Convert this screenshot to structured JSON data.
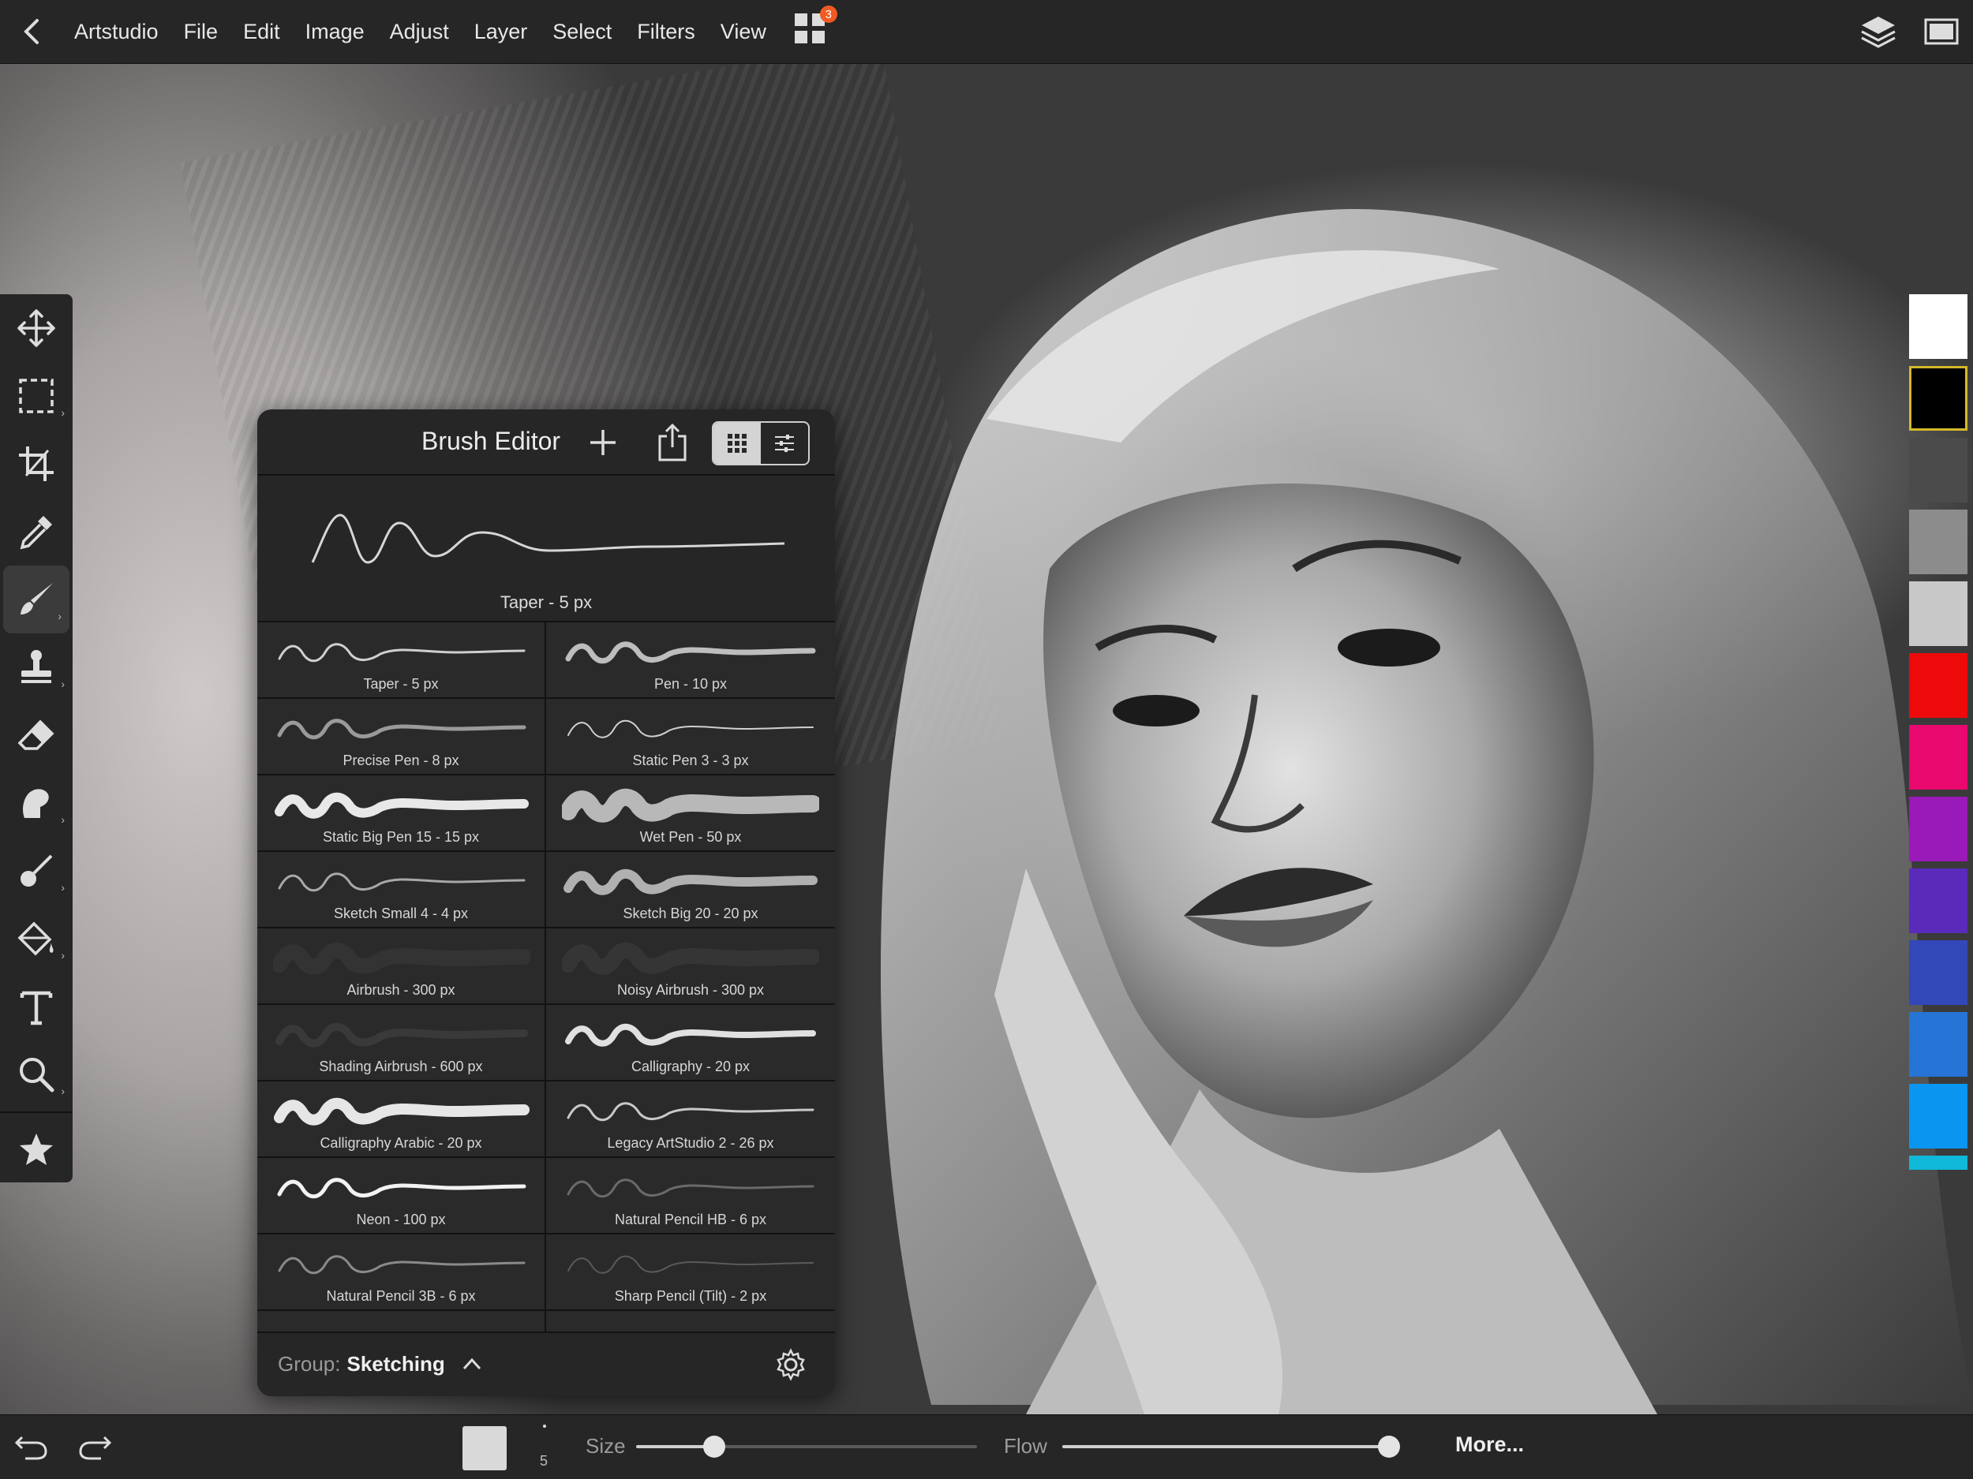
{
  "topbar": {
    "menu": [
      "Artstudio",
      "File",
      "Edit",
      "Image",
      "Adjust",
      "Layer",
      "Select",
      "Filters",
      "View"
    ],
    "apps_badge": "3"
  },
  "toolbar": {
    "tools": [
      "move",
      "rect-select",
      "crop",
      "eyedropper",
      "brush",
      "stamp",
      "eraser",
      "smudge",
      "fill-brush",
      "fill",
      "text",
      "zoom",
      "favorites"
    ],
    "active": "brush"
  },
  "swatches": [
    "#ffffff",
    "#000000",
    "#4b4b4b",
    "#8c8c8c",
    "#c8c8c8",
    "#ee0a0a",
    "#e8086e",
    "#9a19b9",
    "#5a2bbb",
    "#3247b8",
    "#2574d6",
    "#0a95f0",
    "#10b8d9"
  ],
  "brush_editor": {
    "title": "Brush Editor",
    "preview_label": "Taper - 5 px",
    "brushes": [
      "Taper - 5 px",
      "Pen - 10 px",
      "Precise Pen - 8 px",
      "Static Pen 3 - 3 px",
      "Static Big Pen 15 - 15 px",
      "Wet Pen - 50 px",
      "Sketch Small 4 - 4 px",
      "Sketch Big 20 - 20 px",
      "Airbrush - 300 px",
      "Noisy Airbrush - 300 px",
      "Shading Airbrush - 600 px",
      "Calligraphy - 20 px",
      "Calligraphy Arabic - 20 px",
      "Legacy ArtStudio 2 - 26 px",
      "Neon - 100 px",
      "Natural Pencil HB - 6 px",
      "Natural Pencil 3B - 6 px",
      "Sharp Pencil (Tilt) - 2 px",
      "",
      ""
    ],
    "group_label": "Group:",
    "group_value": "Sketching"
  },
  "bottombar": {
    "size_label": "Size",
    "size_value": "5",
    "size_level": 0.23,
    "flow_label": "Flow",
    "flow_level": 1.0,
    "more_label": "More..."
  }
}
